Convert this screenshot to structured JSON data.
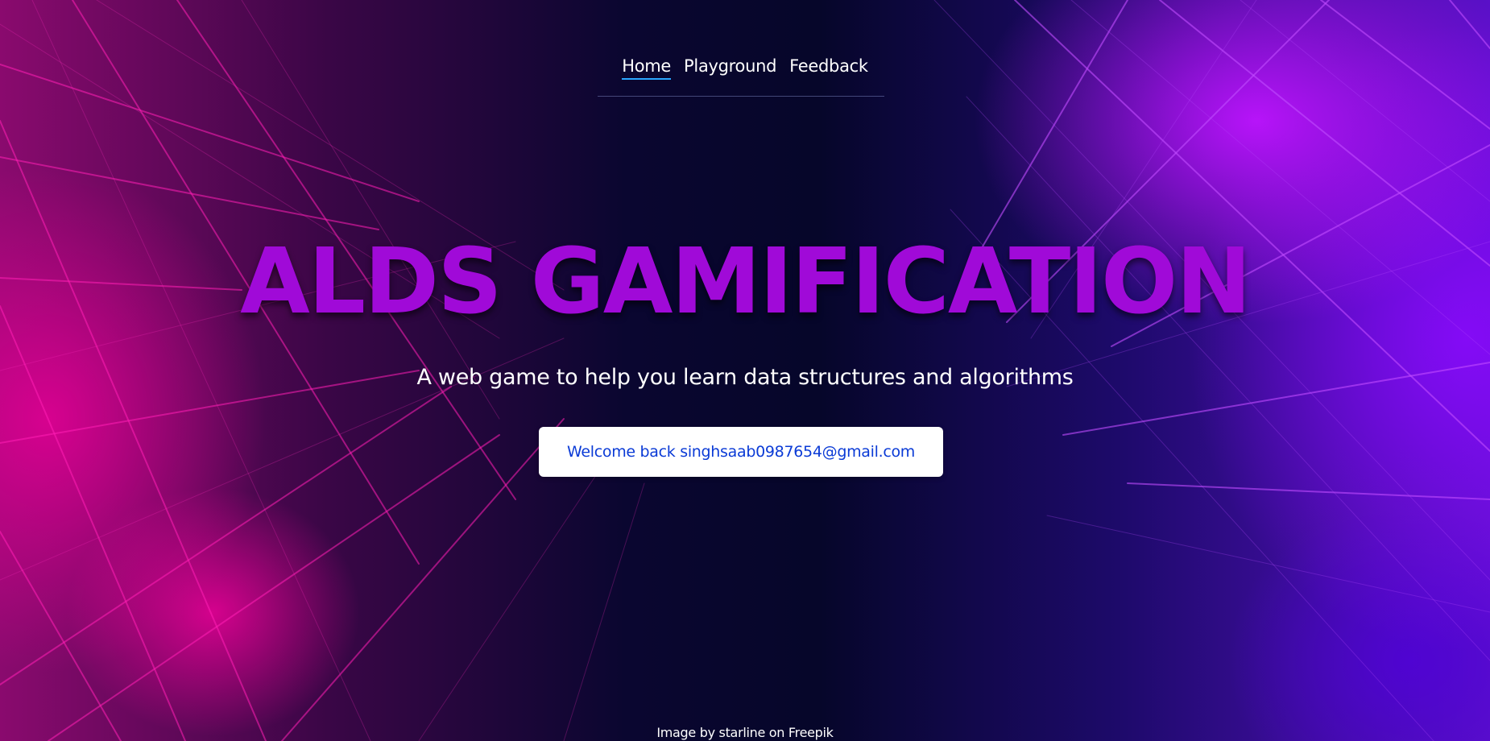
{
  "nav": {
    "items": [
      {
        "label": "Home",
        "active": true
      },
      {
        "label": "Playground",
        "active": false
      },
      {
        "label": "Feedback",
        "active": false
      }
    ]
  },
  "hero": {
    "title": "ALDS GAMIFICATION",
    "subtitle": "A web game to help you learn data structures and algorithms",
    "welcome_button": "Welcome back singhsaab0987654@gmail.com"
  },
  "footer": {
    "credit": "Image by starline on Freepik"
  },
  "colors": {
    "title": "#a00ad8",
    "button_text": "#0b3bd6",
    "nav_active_underline": "#2aa6ff",
    "background_dark": "#06062a"
  }
}
